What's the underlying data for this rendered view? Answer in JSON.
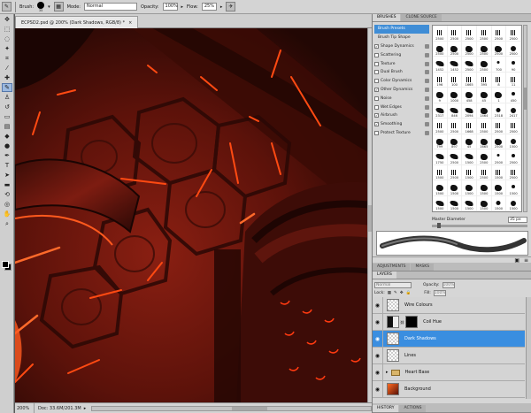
{
  "options_bar": {
    "brush_label": "Brush:",
    "brush_size": "35",
    "mode_label": "Mode:",
    "mode_value": "Normal",
    "opacity_label": "Opacity:",
    "opacity_value": "100%",
    "flow_label": "Flow:",
    "flow_value": "25%"
  },
  "document": {
    "tab_title": "ECPSD2.psd @ 200% (Dark Shadows, RGB/8) *",
    "close_glyph": "×",
    "zoom": "200%",
    "doc_info": "Doc: 33.6M/201.3M"
  },
  "brushes_panel": {
    "tabs": [
      "BRUSHES",
      "CLONE SOURCE"
    ],
    "options": [
      {
        "label": "Brush Presets",
        "checkable": false,
        "checked": false,
        "selected": true
      },
      {
        "label": "Brush Tip Shape",
        "checkable": false,
        "checked": false,
        "selected": false
      },
      {
        "label": "Shape Dynamics",
        "checkable": true,
        "checked": true,
        "selected": false
      },
      {
        "label": "Scattering",
        "checkable": true,
        "checked": false,
        "selected": false
      },
      {
        "label": "Texture",
        "checkable": true,
        "checked": false,
        "selected": false
      },
      {
        "label": "Dual Brush",
        "checkable": true,
        "checked": false,
        "selected": false
      },
      {
        "label": "Color Dynamics",
        "checkable": true,
        "checked": false,
        "selected": false
      },
      {
        "label": "Other Dynamics",
        "checkable": true,
        "checked": true,
        "selected": false
      },
      {
        "label": "Noise",
        "checkable": true,
        "checked": false,
        "selected": false
      },
      {
        "label": "Wet Edges",
        "checkable": true,
        "checked": false,
        "selected": false
      },
      {
        "label": "Airbrush",
        "checkable": true,
        "checked": true,
        "selected": false
      },
      {
        "label": "Smoothing",
        "checkable": true,
        "checked": true,
        "selected": false
      },
      {
        "label": "Protect Texture",
        "checkable": true,
        "checked": false,
        "selected": false
      }
    ],
    "brush_sizes": [
      "2500",
      "2500",
      "2500",
      "2500",
      "2500",
      "2500",
      "2500",
      "2500",
      "2500",
      "2500",
      "2500",
      "2500",
      "1452",
      "1452",
      "2500",
      "2500",
      "700",
      "90",
      "196",
      "100",
      "1665",
      "395",
      "8",
      "11",
      "9",
      "1000",
      "458",
      "45",
      "1",
      "450",
      "2317",
      "846",
      "2094",
      "1464",
      "2318",
      "2417",
      "2500",
      "2500",
      "1668",
      "2500",
      "2500",
      "2500",
      "799",
      "897",
      "45",
      "1665",
      "2500",
      "1500",
      "1750",
      "2500",
      "1500",
      "2500",
      "2500",
      "2500",
      "1500",
      "2500",
      "1500",
      "2500",
      "1500",
      "2500",
      "1500",
      "1500",
      "1500",
      "1500",
      "1500",
      "1500",
      "1500",
      "1500",
      "1500",
      "1500",
      "1500",
      "1500"
    ],
    "master_diameter_label": "Master Diameter",
    "master_diameter_value": "35 px",
    "master_diameter_fraction": 0.06
  },
  "adjustments_tabs": [
    "ADJUSTMENTS",
    "MASKS"
  ],
  "layers_panel": {
    "tabs": [
      "LAYERS"
    ],
    "blend_mode": "Normal",
    "opacity_label": "Opacity:",
    "opacity_value": "100%",
    "lock_label": "Lock:",
    "fill_label": "Fill:",
    "fill_value": "100%",
    "layers": [
      {
        "name": "Wire Colours",
        "selected": false,
        "visible": true,
        "thumb": "transparent",
        "mask": false
      },
      {
        "name": "Coil Hue",
        "selected": false,
        "visible": true,
        "thumb": "adjustment",
        "mask": true
      },
      {
        "name": "Dark Shadows",
        "selected": true,
        "visible": true,
        "thumb": "transparent",
        "mask": false
      },
      {
        "name": "Lines",
        "selected": false,
        "visible": true,
        "thumb": "transparent",
        "mask": false
      },
      {
        "name": "Heart Base",
        "selected": false,
        "visible": true,
        "thumb": "folder",
        "mask": false
      },
      {
        "name": "Background",
        "selected": false,
        "visible": true,
        "thumb": "image",
        "mask": false
      }
    ]
  },
  "history_tabs": [
    "HISTORY",
    "ACTIONS"
  ],
  "colors": {
    "selection_blue": "#3a8ee0",
    "canvas_dark": "#2b0a05",
    "canvas_red": "#7a1a10",
    "glow_orange": "#ff4a12",
    "foreground_swatch": "#000000"
  }
}
